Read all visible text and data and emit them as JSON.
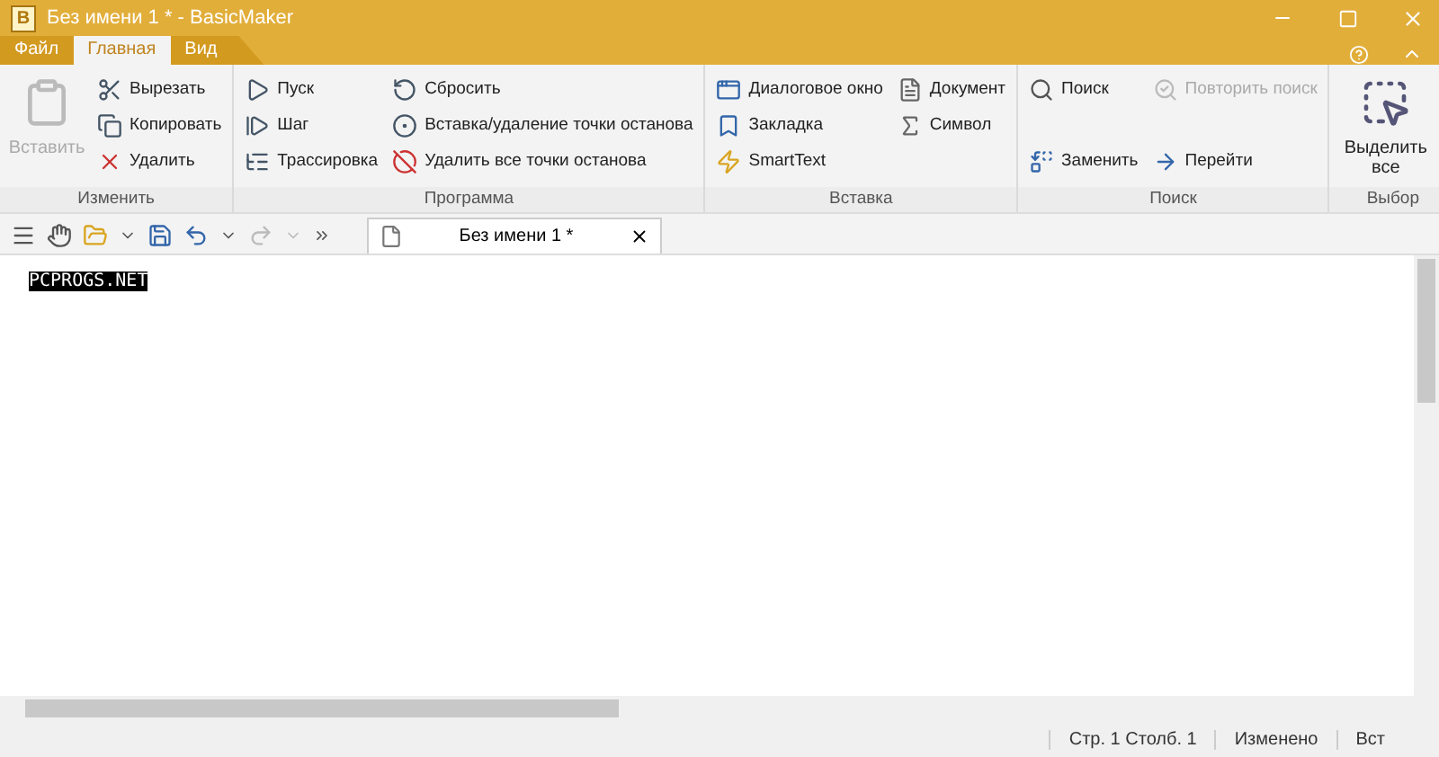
{
  "window": {
    "title": "Без имени 1 * - BasicMaker",
    "app_letter": "B"
  },
  "ribbon_tabs": [
    {
      "label": "Файл",
      "selected": false
    },
    {
      "label": "Главная",
      "selected": true
    },
    {
      "label": "Вид",
      "selected": false
    }
  ],
  "ribbon_groups": [
    {
      "label": "Изменить",
      "columns": [
        [
          {
            "label": "Вставить",
            "kind": "large",
            "disabled": true
          }
        ],
        [
          {
            "label": "Вырезать",
            "kind": "small",
            "disabled": false
          },
          {
            "label": "Копировать",
            "kind": "small",
            "disabled": false
          },
          {
            "label": "Удалить",
            "kind": "small",
            "disabled": false
          }
        ]
      ]
    },
    {
      "label": "Программа",
      "columns": [
        [
          {
            "label": "Пуск",
            "kind": "small",
            "disabled": false
          },
          {
            "label": "Шаг",
            "kind": "small",
            "disabled": false
          },
          {
            "label": "Трассировка",
            "kind": "small",
            "disabled": false
          }
        ],
        [
          {
            "label": "Сбросить",
            "kind": "small",
            "disabled": false
          },
          {
            "label": "Вставка/удаление точки останова",
            "kind": "small",
            "disabled": false
          },
          {
            "label": "Удалить все точки останова",
            "kind": "small",
            "disabled": false
          }
        ]
      ]
    },
    {
      "label": "Вставка",
      "columns": [
        [
          {
            "label": "Диалоговое окно",
            "kind": "small",
            "disabled": false
          },
          {
            "label": "Закладка",
            "kind": "small",
            "disabled": false
          },
          {
            "label": "SmartText",
            "kind": "small",
            "disabled": false
          }
        ],
        [
          {
            "label": "Документ",
            "kind": "small",
            "disabled": false
          },
          {
            "label": "Символ",
            "kind": "small",
            "disabled": false
          }
        ]
      ]
    },
    {
      "label": "Поиск",
      "columns": [
        [
          {
            "label": "Поиск",
            "kind": "small",
            "disabled": false
          },
          {
            "label": "Заменить",
            "kind": "small",
            "disabled": false
          }
        ],
        [
          {
            "label": "Повторить поиск",
            "kind": "small",
            "disabled": true
          },
          {
            "label": "Перейти",
            "kind": "small",
            "disabled": false
          }
        ]
      ]
    },
    {
      "label": "Выбор",
      "columns": [
        [
          {
            "label": "Выделить все",
            "kind": "large",
            "disabled": false
          }
        ]
      ]
    }
  ],
  "quick_toolbar": {
    "redo_disabled": true
  },
  "document_tabs": [
    {
      "label": "Без имени 1 *",
      "selected": true
    }
  ],
  "editor": {
    "text": "PCPROGS.NET",
    "selected": true
  },
  "status_bar": [
    "Стр. 1 Столб. 1",
    "Изменено",
    "Вст"
  ]
}
